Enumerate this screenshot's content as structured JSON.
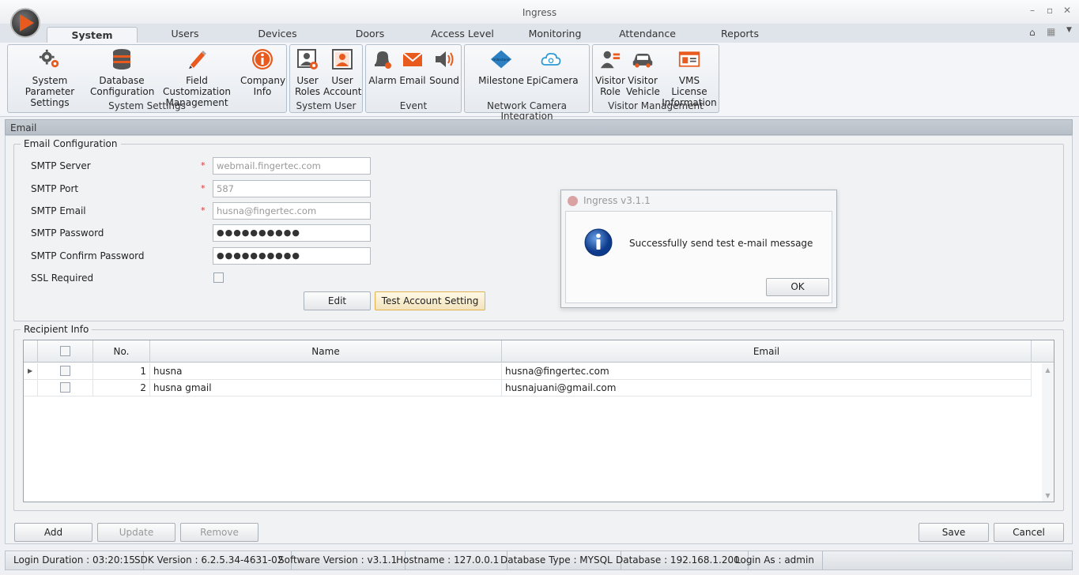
{
  "window": {
    "title": "Ingress",
    "minimize": "–",
    "restore": "▫",
    "close": "✕"
  },
  "tabs": [
    {
      "label": "System Settings"
    },
    {
      "label": "Users"
    },
    {
      "label": "Devices"
    },
    {
      "label": "Doors"
    },
    {
      "label": "Access Level"
    },
    {
      "label": "Monitoring"
    },
    {
      "label": "Attendance"
    },
    {
      "label": "Reports"
    }
  ],
  "ribbon": {
    "groups": [
      {
        "label": "System Settings",
        "items": [
          {
            "line1": "System Parameter",
            "line2": "Settings",
            "icon": "gears-icon"
          },
          {
            "line1": "Database",
            "line2": "Configuration",
            "icon": "database-icon"
          },
          {
            "line1": "Field Customization",
            "line2": "Management",
            "icon": "pencil-icon"
          },
          {
            "line1": "Company",
            "line2": "Info",
            "icon": "info-icon"
          }
        ]
      },
      {
        "label": "System User",
        "items": [
          {
            "line1": "User",
            "line2": "Roles",
            "icon": "user-roles-icon"
          },
          {
            "line1": "User",
            "line2": "Account",
            "icon": "user-account-icon"
          }
        ]
      },
      {
        "label": "Event",
        "items": [
          {
            "line1": "Alarm",
            "line2": "",
            "icon": "bell-icon"
          },
          {
            "line1": "Email",
            "line2": "",
            "icon": "envelope-icon"
          },
          {
            "line1": "Sound",
            "line2": "",
            "icon": "speaker-icon"
          }
        ]
      },
      {
        "label": "Network Camera Integration",
        "items": [
          {
            "line1": "Milestone",
            "line2": "",
            "icon": "milestone-icon",
            "logo_text": "milestone"
          },
          {
            "line1": "EpiCamera",
            "line2": "",
            "icon": "cloud-camera-icon"
          }
        ]
      },
      {
        "label": "Visitor Management",
        "items": [
          {
            "line1": "Visitor",
            "line2": "Role",
            "icon": "visitor-role-icon"
          },
          {
            "line1": "Visitor",
            "line2": "Vehicle",
            "icon": "car-icon"
          },
          {
            "line1": "VMS License",
            "line2": "Information",
            "icon": "license-card-icon"
          }
        ]
      }
    ]
  },
  "panel": {
    "title": "Email"
  },
  "email_config": {
    "legend": "Email Configuration",
    "required_mark": "*",
    "fields": [
      {
        "label": "SMTP Server",
        "value": "webmail.fingertec.com"
      },
      {
        "label": "SMTP Port",
        "value": "587"
      },
      {
        "label": "SMTP Email",
        "value": "husna@fingertec.com"
      },
      {
        "label": "SMTP Password",
        "value": "●●●●●●●●●●"
      },
      {
        "label": "SMTP Confirm Password",
        "value": "●●●●●●●●●●"
      }
    ],
    "ssl_label": "SSL Required",
    "edit_label": "Edit",
    "test_label": "Test Account Setting"
  },
  "recipient": {
    "legend": "Recipient Info",
    "columns": {
      "no": "No.",
      "name": "Name",
      "email": "Email"
    },
    "rows": [
      {
        "no": "1",
        "name": "husna",
        "email": "husna@fingertec.com"
      },
      {
        "no": "2",
        "name": "husna gmail",
        "email": "husnajuani@gmail.com"
      }
    ]
  },
  "actions": {
    "add": "Add",
    "update": "Update",
    "remove": "Remove",
    "save": "Save",
    "cancel": "Cancel"
  },
  "dialog": {
    "title": "Ingress v3.1.1",
    "message": "Successfully send test e-mail message",
    "ok": "OK"
  },
  "status": [
    "Login Duration : 03:20:15",
    "SDK Version : 6.2.5.34-4631-02",
    "Software Version : v3.1.1",
    "Hostname : 127.0.0.1",
    "Database Type : MYSQL",
    "Database : 192.168.1.200",
    "Login As : admin"
  ],
  "colors": {
    "accent": "#e85a1e",
    "focus_border": "#e2b04c",
    "info_blue": "#1a4fa0"
  }
}
